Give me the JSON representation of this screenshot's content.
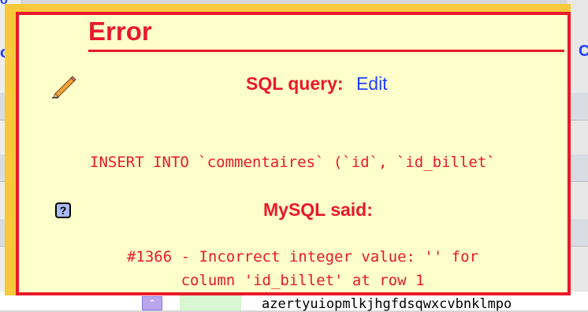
{
  "background": {
    "left_link_glyph": "o",
    "right_link_glyph": "C",
    "top_link_glyph": "o",
    "row_text": "azertyuiopmlkjhgfdsqwxcvbnklmpo",
    "sort_glyph": "⌃"
  },
  "error_dialog": {
    "title": "Error",
    "sql_query_label": "SQL query:",
    "edit_link": "Edit",
    "query": "INSERT INTO `commentaires` (`id`, `id_billet`",
    "mysql_said_label": "MySQL said:",
    "help_glyph": "?",
    "message_line1": "#1366 - Incorrect integer value: '' for",
    "message_line2": "column 'id_billet' at row 1"
  },
  "colors": {
    "error_red": "#e8192a",
    "dialog_bg": "#ffffcc",
    "frame_yellow": "#f7c93b",
    "link_blue": "#1f3fff"
  }
}
